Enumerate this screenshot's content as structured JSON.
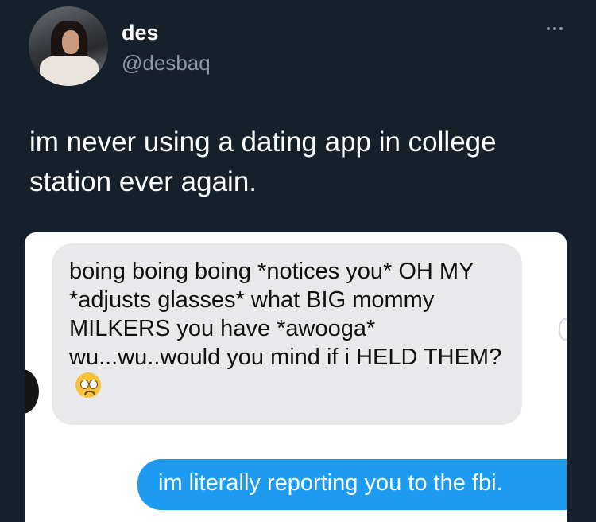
{
  "author": {
    "display_name": "des",
    "handle": "@desbaq",
    "avatar_icon": "profile-photo"
  },
  "tweet": {
    "text": "im never using a dating app in college station ever again."
  },
  "chat": {
    "incoming_message": "boing boing boing *notices you* OH MY *adjusts glasses* what BIG mommy MILKERS you have *awooga* wu...wu..would you mind if i HELD THEM?",
    "incoming_emoji": "pleading-face-emoji",
    "outgoing_message": "im literally reporting you to the fbi."
  },
  "colors": {
    "background": "#15202b",
    "incoming_bubble": "#e9e9eb",
    "outgoing_bubble": "#1d9bf0"
  }
}
